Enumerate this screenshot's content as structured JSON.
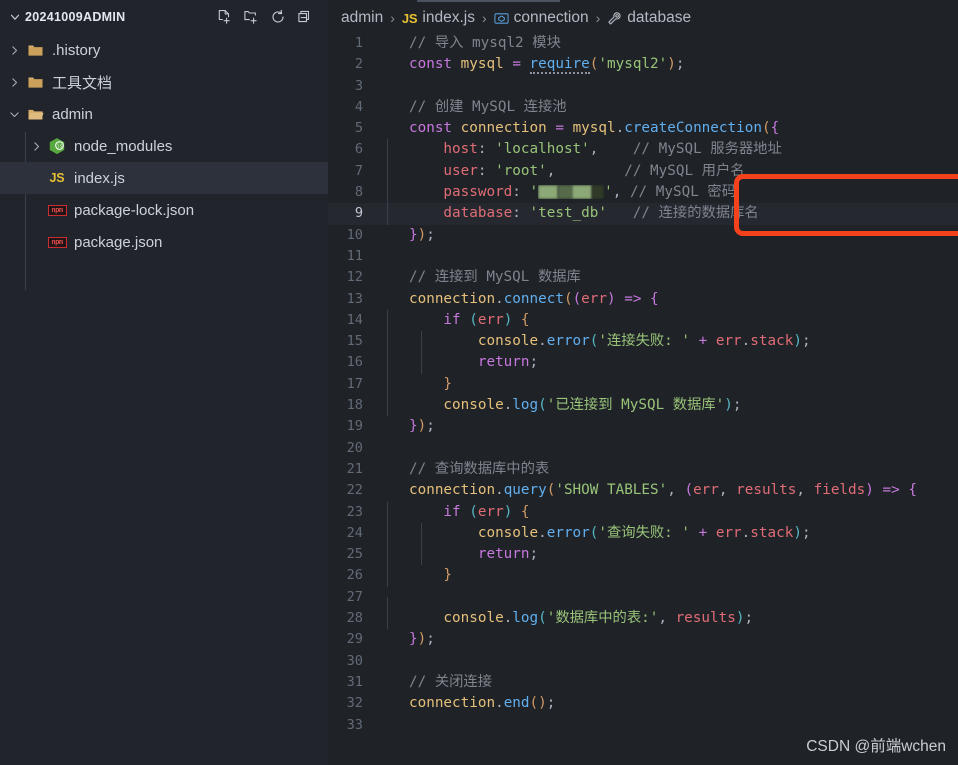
{
  "sidebar": {
    "title": "20241009ADMIN",
    "actions": [
      {
        "name": "new-file-icon",
        "label": "New File"
      },
      {
        "name": "new-folder-icon",
        "label": "New Folder"
      },
      {
        "name": "refresh-icon",
        "label": "Refresh Explorer"
      },
      {
        "name": "collapse-all-icon",
        "label": "Collapse Folders in Explorer"
      }
    ],
    "tree": [
      {
        "label": ".history",
        "icon": "folder",
        "indent": 1,
        "expanded": false,
        "selected": false
      },
      {
        "label": "工具文档",
        "icon": "folder",
        "indent": 1,
        "expanded": false,
        "selected": false
      },
      {
        "label": "admin",
        "icon": "folder-open",
        "indent": 1,
        "expanded": true,
        "selected": false
      },
      {
        "label": "node_modules",
        "icon": "node",
        "indent": 2,
        "expanded": false,
        "selected": false
      },
      {
        "label": "index.js",
        "icon": "js",
        "indent": 2,
        "expanded": null,
        "selected": true
      },
      {
        "label": "package-lock.json",
        "icon": "npm",
        "indent": 2,
        "expanded": null,
        "selected": false
      },
      {
        "label": "package.json",
        "icon": "npm",
        "indent": 2,
        "expanded": null,
        "selected": false
      }
    ]
  },
  "breadcrumb": [
    {
      "label": "admin",
      "icon": "none"
    },
    {
      "label": "index.js",
      "icon": "js"
    },
    {
      "label": "connection",
      "icon": "variable"
    },
    {
      "label": "database",
      "icon": "property"
    }
  ],
  "editor": {
    "active_line": 9,
    "total_lines": 33,
    "lines": [
      {
        "n": 1,
        "segments": [
          {
            "c": "t-com",
            "t": "// 导入 mysql2 模块"
          }
        ]
      },
      {
        "n": 2,
        "segments": [
          {
            "c": "t-key",
            "t": "const"
          },
          {
            "c": "t-punc",
            "t": " "
          },
          {
            "c": "t-var",
            "t": "mysql"
          },
          {
            "c": "t-punc",
            "t": " "
          },
          {
            "c": "t-op",
            "t": "="
          },
          {
            "c": "t-punc",
            "t": " "
          },
          {
            "c": "t-fn sugg",
            "t": "require"
          },
          {
            "c": "t-br1",
            "t": "("
          },
          {
            "c": "t-str",
            "t": "'mysql2'"
          },
          {
            "c": "t-br1",
            "t": ")"
          },
          {
            "c": "t-punc",
            "t": ";"
          }
        ]
      },
      {
        "n": 3,
        "segments": []
      },
      {
        "n": 4,
        "segments": [
          {
            "c": "t-com",
            "t": "// 创建 MySQL 连接池"
          }
        ]
      },
      {
        "n": 5,
        "segments": [
          {
            "c": "t-key",
            "t": "const"
          },
          {
            "c": "t-punc",
            "t": " "
          },
          {
            "c": "t-var",
            "t": "connection"
          },
          {
            "c": "t-punc",
            "t": " "
          },
          {
            "c": "t-op",
            "t": "="
          },
          {
            "c": "t-punc",
            "t": " "
          },
          {
            "c": "t-var",
            "t": "mysql"
          },
          {
            "c": "t-punc",
            "t": "."
          },
          {
            "c": "t-fn",
            "t": "createConnection"
          },
          {
            "c": "t-br1",
            "t": "("
          },
          {
            "c": "t-br2",
            "t": "{"
          }
        ]
      },
      {
        "n": 6,
        "indent": 1,
        "segments": [
          {
            "c": "t-prop",
            "t": "    host"
          },
          {
            "c": "t-punc",
            "t": ": "
          },
          {
            "c": "t-str",
            "t": "'localhost'"
          },
          {
            "c": "t-punc",
            "t": ","
          },
          {
            "c": "t-com",
            "t": "    // MySQL 服务器地址"
          }
        ]
      },
      {
        "n": 7,
        "indent": 1,
        "segments": [
          {
            "c": "t-prop",
            "t": "    user"
          },
          {
            "c": "t-punc",
            "t": ": "
          },
          {
            "c": "t-str",
            "t": "'root'"
          },
          {
            "c": "t-punc",
            "t": ","
          },
          {
            "c": "t-com",
            "t": "        // MySQL 用户名"
          }
        ]
      },
      {
        "n": 8,
        "indent": 1,
        "redacted": true,
        "segments": [
          {
            "c": "t-prop",
            "t": "    password"
          },
          {
            "c": "t-punc",
            "t": ": "
          },
          {
            "c": "t-str",
            "t": "'"
          },
          {
            "c": "redact",
            "t": ""
          },
          {
            "c": "t-str",
            "t": "'"
          },
          {
            "c": "t-punc",
            "t": ","
          },
          {
            "c": "t-com",
            "t": " // MySQL 密码"
          }
        ]
      },
      {
        "n": 9,
        "indent": 1,
        "segments": [
          {
            "c": "t-prop",
            "t": "    database"
          },
          {
            "c": "t-punc",
            "t": ": "
          },
          {
            "c": "t-str",
            "t": "'test_db'"
          },
          {
            "c": "t-com",
            "t": "   // 连接的数据库名"
          }
        ]
      },
      {
        "n": 10,
        "segments": [
          {
            "c": "t-br2",
            "t": "}"
          },
          {
            "c": "t-br1",
            "t": ")"
          },
          {
            "c": "t-punc",
            "t": ";"
          }
        ]
      },
      {
        "n": 11,
        "segments": []
      },
      {
        "n": 12,
        "segments": [
          {
            "c": "t-com",
            "t": "// 连接到 MySQL 数据库"
          }
        ]
      },
      {
        "n": 13,
        "segments": [
          {
            "c": "t-var",
            "t": "connection"
          },
          {
            "c": "t-punc",
            "t": "."
          },
          {
            "c": "t-fn",
            "t": "connect"
          },
          {
            "c": "t-br1",
            "t": "("
          },
          {
            "c": "t-br2",
            "t": "("
          },
          {
            "c": "t-par",
            "t": "err"
          },
          {
            "c": "t-br2",
            "t": ")"
          },
          {
            "c": "t-punc",
            "t": " "
          },
          {
            "c": "t-op",
            "t": "=>"
          },
          {
            "c": "t-punc",
            "t": " "
          },
          {
            "c": "t-br2",
            "t": "{"
          }
        ]
      },
      {
        "n": 14,
        "indent": 1,
        "segments": [
          {
            "c": "t-key",
            "t": "    if"
          },
          {
            "c": "t-punc",
            "t": " "
          },
          {
            "c": "t-br3",
            "t": "("
          },
          {
            "c": "t-par",
            "t": "err"
          },
          {
            "c": "t-br3",
            "t": ")"
          },
          {
            "c": "t-punc",
            "t": " "
          },
          {
            "c": "t-br1",
            "t": "{"
          }
        ]
      },
      {
        "n": 15,
        "indent": 2,
        "segments": [
          {
            "c": "t-var",
            "t": "        console"
          },
          {
            "c": "t-punc",
            "t": "."
          },
          {
            "c": "t-fn",
            "t": "error"
          },
          {
            "c": "t-br3",
            "t": "("
          },
          {
            "c": "t-str",
            "t": "'连接失败: '"
          },
          {
            "c": "t-punc",
            "t": " "
          },
          {
            "c": "t-op",
            "t": "+"
          },
          {
            "c": "t-punc",
            "t": " "
          },
          {
            "c": "t-par",
            "t": "err"
          },
          {
            "c": "t-punc",
            "t": "."
          },
          {
            "c": "t-prop",
            "t": "stack"
          },
          {
            "c": "t-br3",
            "t": ")"
          },
          {
            "c": "t-punc",
            "t": ";"
          }
        ]
      },
      {
        "n": 16,
        "indent": 2,
        "segments": [
          {
            "c": "t-key",
            "t": "        return"
          },
          {
            "c": "t-punc",
            "t": ";"
          }
        ]
      },
      {
        "n": 17,
        "indent": 1,
        "segments": [
          {
            "c": "t-br1",
            "t": "    }"
          }
        ]
      },
      {
        "n": 18,
        "indent": 1,
        "segments": [
          {
            "c": "t-var",
            "t": "    console"
          },
          {
            "c": "t-punc",
            "t": "."
          },
          {
            "c": "t-fn",
            "t": "log"
          },
          {
            "c": "t-br3",
            "t": "("
          },
          {
            "c": "t-str",
            "t": "'已连接到 MySQL 数据库'"
          },
          {
            "c": "t-br3",
            "t": ")"
          },
          {
            "c": "t-punc",
            "t": ";"
          }
        ]
      },
      {
        "n": 19,
        "segments": [
          {
            "c": "t-br2",
            "t": "}"
          },
          {
            "c": "t-br1",
            "t": ")"
          },
          {
            "c": "t-punc",
            "t": ";"
          }
        ]
      },
      {
        "n": 20,
        "segments": []
      },
      {
        "n": 21,
        "segments": [
          {
            "c": "t-com",
            "t": "// 查询数据库中的表"
          }
        ]
      },
      {
        "n": 22,
        "segments": [
          {
            "c": "t-var",
            "t": "connection"
          },
          {
            "c": "t-punc",
            "t": "."
          },
          {
            "c": "t-fn",
            "t": "query"
          },
          {
            "c": "t-br1",
            "t": "("
          },
          {
            "c": "t-str",
            "t": "'SHOW TABLES'"
          },
          {
            "c": "t-punc",
            "t": ", "
          },
          {
            "c": "t-br2",
            "t": "("
          },
          {
            "c": "t-par",
            "t": "err"
          },
          {
            "c": "t-punc",
            "t": ", "
          },
          {
            "c": "t-par",
            "t": "results"
          },
          {
            "c": "t-punc",
            "t": ", "
          },
          {
            "c": "t-par",
            "t": "fields"
          },
          {
            "c": "t-br2",
            "t": ")"
          },
          {
            "c": "t-punc",
            "t": " "
          },
          {
            "c": "t-op",
            "t": "=>"
          },
          {
            "c": "t-punc",
            "t": " "
          },
          {
            "c": "t-br2",
            "t": "{"
          }
        ]
      },
      {
        "n": 23,
        "indent": 1,
        "segments": [
          {
            "c": "t-key",
            "t": "    if"
          },
          {
            "c": "t-punc",
            "t": " "
          },
          {
            "c": "t-br3",
            "t": "("
          },
          {
            "c": "t-par",
            "t": "err"
          },
          {
            "c": "t-br3",
            "t": ")"
          },
          {
            "c": "t-punc",
            "t": " "
          },
          {
            "c": "t-br1",
            "t": "{"
          }
        ]
      },
      {
        "n": 24,
        "indent": 2,
        "segments": [
          {
            "c": "t-var",
            "t": "        console"
          },
          {
            "c": "t-punc",
            "t": "."
          },
          {
            "c": "t-fn",
            "t": "error"
          },
          {
            "c": "t-br3",
            "t": "("
          },
          {
            "c": "t-str",
            "t": "'查询失败: '"
          },
          {
            "c": "t-punc",
            "t": " "
          },
          {
            "c": "t-op",
            "t": "+"
          },
          {
            "c": "t-punc",
            "t": " "
          },
          {
            "c": "t-par",
            "t": "err"
          },
          {
            "c": "t-punc",
            "t": "."
          },
          {
            "c": "t-prop",
            "t": "stack"
          },
          {
            "c": "t-br3",
            "t": ")"
          },
          {
            "c": "t-punc",
            "t": ";"
          }
        ]
      },
      {
        "n": 25,
        "indent": 2,
        "segments": [
          {
            "c": "t-key",
            "t": "        return"
          },
          {
            "c": "t-punc",
            "t": ";"
          }
        ]
      },
      {
        "n": 26,
        "indent": 1,
        "segments": [
          {
            "c": "t-br1",
            "t": "    }"
          }
        ]
      },
      {
        "n": 27,
        "indent": 1,
        "segments": []
      },
      {
        "n": 28,
        "indent": 1,
        "segments": [
          {
            "c": "t-var",
            "t": "    console"
          },
          {
            "c": "t-punc",
            "t": "."
          },
          {
            "c": "t-fn",
            "t": "log"
          },
          {
            "c": "t-br3",
            "t": "("
          },
          {
            "c": "t-str",
            "t": "'数据库中的表:'"
          },
          {
            "c": "t-punc",
            "t": ", "
          },
          {
            "c": "t-par",
            "t": "results"
          },
          {
            "c": "t-br3",
            "t": ")"
          },
          {
            "c": "t-punc",
            "t": ";"
          }
        ]
      },
      {
        "n": 29,
        "segments": [
          {
            "c": "t-br2",
            "t": "}"
          },
          {
            "c": "t-br1",
            "t": ")"
          },
          {
            "c": "t-punc",
            "t": ";"
          }
        ]
      },
      {
        "n": 30,
        "segments": []
      },
      {
        "n": 31,
        "segments": [
          {
            "c": "t-com",
            "t": "// 关闭连接"
          }
        ]
      },
      {
        "n": 32,
        "segments": [
          {
            "c": "t-var",
            "t": "connection"
          },
          {
            "c": "t-punc",
            "t": "."
          },
          {
            "c": "t-fn",
            "t": "end"
          },
          {
            "c": "t-br1",
            "t": "("
          },
          {
            "c": "t-br1",
            "t": ")"
          },
          {
            "c": "t-punc",
            "t": ";"
          }
        ]
      },
      {
        "n": 33,
        "segments": []
      }
    ]
  },
  "annotation": {
    "type": "rectangle-highlight",
    "color": "#f4421c",
    "covers_lines": [
      8,
      9
    ]
  },
  "watermark": "CSDN @前端wchen",
  "colors": {
    "sidebar_bg": "#21242b",
    "editor_bg": "#1f2227",
    "selected_row": "#2c313c",
    "active_line": "#25282f",
    "accent_red": "#f4421c",
    "js_yellow": "#e5c032",
    "folder_gold": "#cba05a",
    "node_green": "#57a83f",
    "npm_red": "#c63030"
  }
}
